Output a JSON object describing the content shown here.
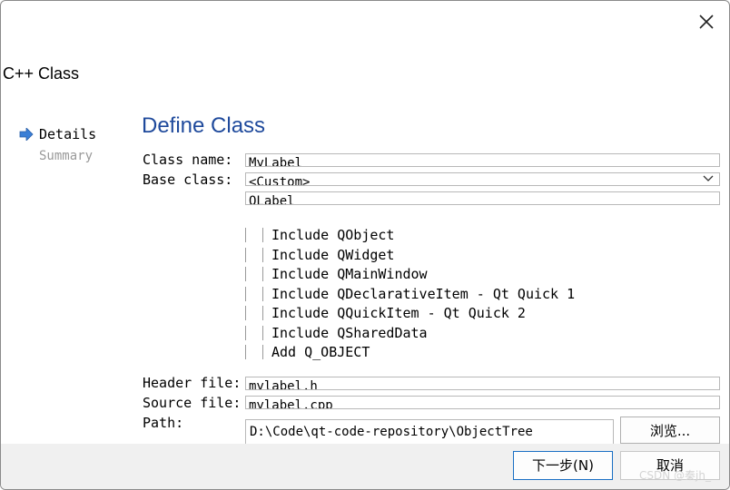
{
  "wizard": {
    "title": "C++ Class",
    "steps": [
      "Details",
      "Summary"
    ],
    "heading": "Define Class"
  },
  "form": {
    "class_name_label": "Class name:",
    "class_name_value": "MyLabel",
    "base_class_label": "Base class:",
    "base_class_selected": "<Custom>",
    "custom_base_value": "QLabel",
    "checkboxes": [
      {
        "label": "Include QObject",
        "checked": false
      },
      {
        "label": "Include QWidget",
        "checked": false
      },
      {
        "label": "Include QMainWindow",
        "checked": false
      },
      {
        "label": "Include QDeclarativeItem - Qt Quick 1",
        "checked": false
      },
      {
        "label": "Include QQuickItem - Qt Quick 2",
        "checked": false
      },
      {
        "label": "Include QSharedData",
        "checked": false
      },
      {
        "label": "Add Q_OBJECT",
        "checked": false
      }
    ],
    "header_file_label": "Header file:",
    "header_file_value": "mylabel.h",
    "source_file_label": "Source file:",
    "source_file_value": "mylabel.cpp",
    "path_label": "Path:",
    "path_value": "D:\\Code\\qt-code-repository\\ObjectTree",
    "browse_label": "浏览..."
  },
  "footer": {
    "next_label": "下一步(N)",
    "cancel_label": "取消"
  },
  "watermark": "CSDN @秦jh_",
  "colors": {
    "heading": "#1f4a9c",
    "arrow": "#3b7fd6",
    "primary_border": "#1a6fc4"
  }
}
